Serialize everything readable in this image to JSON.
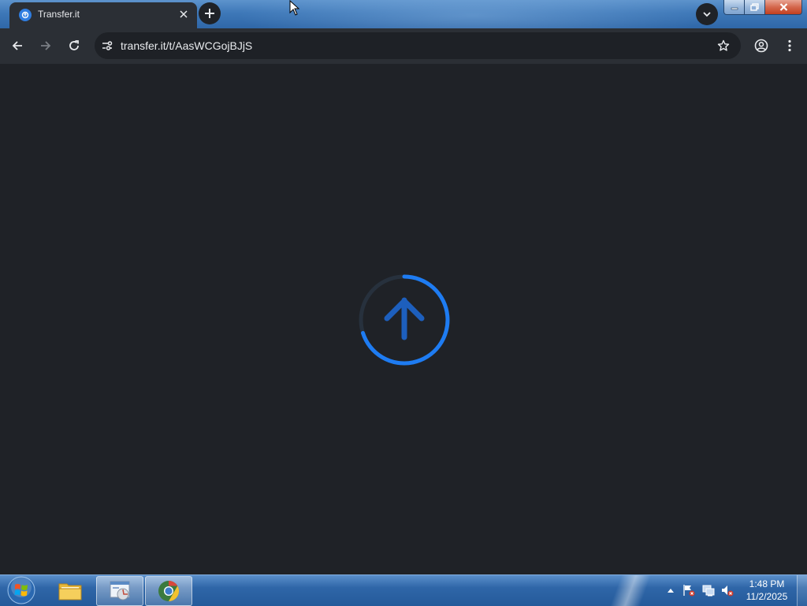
{
  "browser": {
    "tab": {
      "title": "Transfer.it",
      "favicon": "transfer-it-favicon"
    },
    "address_bar": {
      "url": "transfer.it/t/AasWCGojBJjS"
    },
    "icons": {
      "back": "back-arrow-icon",
      "forward": "forward-arrow-icon",
      "reload": "reload-icon",
      "site_info": "site-settings-icon",
      "bookmark": "star-icon",
      "profile": "profile-icon",
      "menu": "kebab-menu-icon"
    }
  },
  "page": {
    "loader": {
      "icon": "upload-arrow-icon",
      "color": "#1e7cf2"
    }
  },
  "taskbar": {
    "clock": {
      "time": "1:48 PM",
      "date": "11/2/2025"
    },
    "pinned": [
      "file-explorer",
      "control-panel",
      "chrome"
    ]
  },
  "colors": {
    "content_bg": "#1f2227",
    "toolbar_bg": "#2b2f35",
    "accent": "#1e7cf2"
  }
}
